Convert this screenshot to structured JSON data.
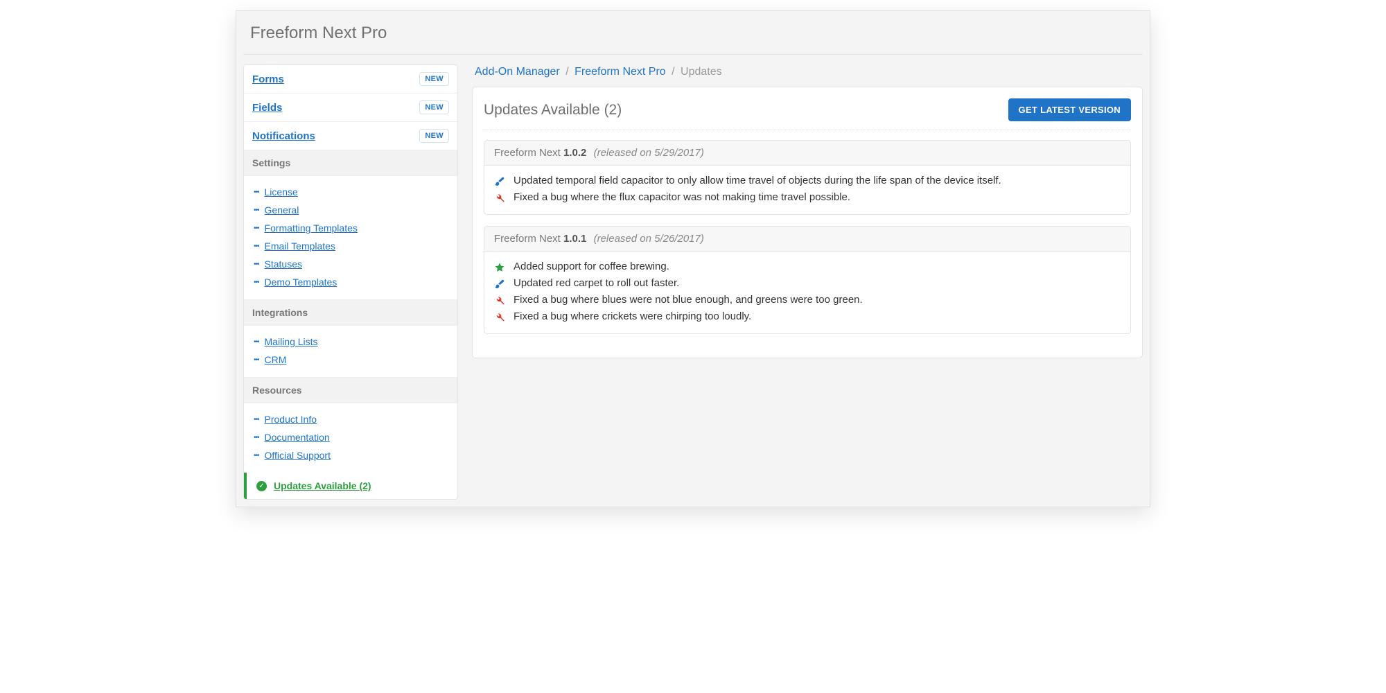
{
  "page_title": "Freeform Next Pro",
  "sidebar": {
    "top": [
      {
        "label": "Forms",
        "badge": "NEW"
      },
      {
        "label": "Fields",
        "badge": "NEW"
      },
      {
        "label": "Notifications",
        "badge": "NEW"
      }
    ],
    "sections": [
      {
        "title": "Settings",
        "items": [
          "License",
          "General",
          "Formatting Templates",
          "Email Templates",
          "Statuses",
          "Demo Templates"
        ]
      },
      {
        "title": "Integrations",
        "items": [
          "Mailing Lists",
          "CRM"
        ]
      },
      {
        "title": "Resources",
        "items": [
          "Product Info",
          "Documentation",
          "Official Support"
        ]
      }
    ],
    "active": {
      "label": "Updates Available (2)"
    }
  },
  "breadcrumb": {
    "a": "Add-On Manager",
    "b": "Freeform Next Pro",
    "current": "Updates"
  },
  "panel": {
    "title": "Updates Available (2)",
    "button": "GET LATEST VERSION"
  },
  "updates": [
    {
      "product": "Freeform Next",
      "version": "1.0.2",
      "date": "(released on 5/29/2017)",
      "notes": [
        {
          "type": "changed",
          "text": "Updated temporal field capacitor to only allow time travel of objects during the life span of the device itself."
        },
        {
          "type": "fixed",
          "text": "Fixed a bug where the flux capacitor was not making time travel possible."
        }
      ]
    },
    {
      "product": "Freeform Next",
      "version": "1.0.1",
      "date": "(released on 5/26/2017)",
      "notes": [
        {
          "type": "added",
          "text": "Added support for coffee brewing."
        },
        {
          "type": "changed",
          "text": "Updated red carpet to roll out faster."
        },
        {
          "type": "fixed",
          "text": "Fixed a bug where blues were not blue enough, and greens were too green."
        },
        {
          "type": "fixed",
          "text": "Fixed a bug where crickets were chirping too loudly."
        }
      ]
    }
  ],
  "colors": {
    "added": "#2e9e3f",
    "changed": "#1f74c7",
    "fixed": "#d93a2b"
  }
}
